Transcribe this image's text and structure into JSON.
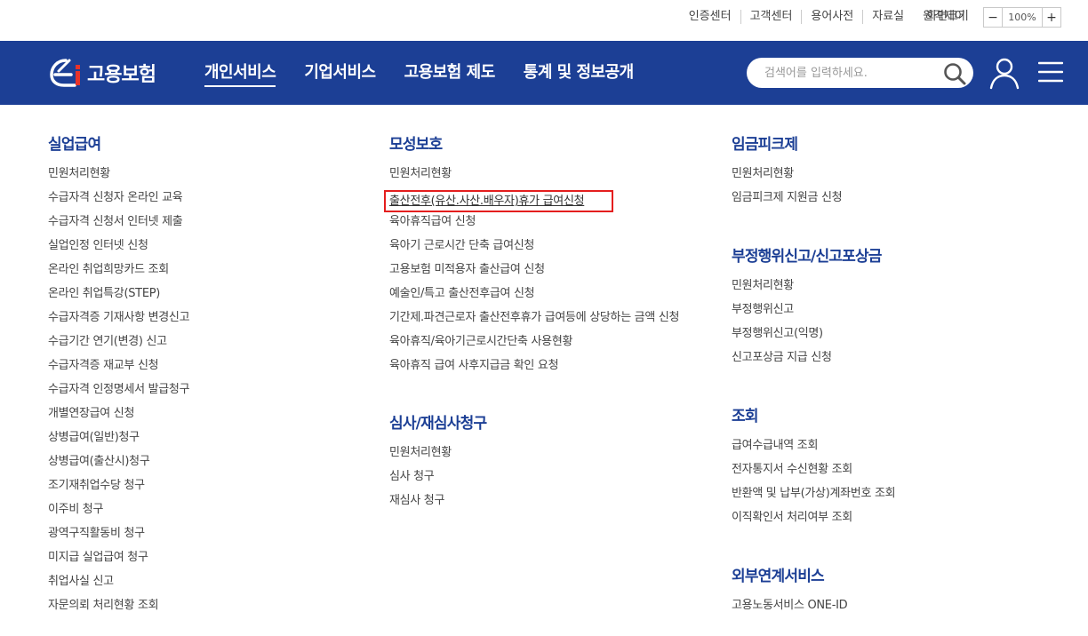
{
  "util": {
    "links": [
      "인증센터",
      "고객센터",
      "용어사전",
      "자료실",
      "원격제어"
    ],
    "zoom_label": "화면크기",
    "zoom_minus": "−",
    "zoom_value": "100%",
    "zoom_plus": "+"
  },
  "header": {
    "logo_text": "고용보험",
    "menus": [
      "개인서비스",
      "기업서비스",
      "고용보험 제도",
      "통계 및 정보공개"
    ],
    "active_menu": "개인서비스",
    "search_placeholder": "검색어를 입력하세요.",
    "brand_color": "#1c3f95"
  },
  "columns": {
    "col1": {
      "sections": [
        {
          "title": "실업급여",
          "items": [
            "민원처리현황",
            "수급자격 신청자 온라인 교육",
            "수급자격 신청서 인터넷 제출",
            "실업인정 인터넷 신청",
            "온라인 취업희망카드 조회",
            "온라인 취업특강(STEP)",
            "수급자격증 기재사항 변경신고",
            "수급기간 연기(변경) 신고",
            "수급자격증 재교부 신청",
            "수급자격 인정명세서 발급청구",
            "개별연장급여 신청",
            "상병급여(일반)청구",
            "상병급여(출산시)청구",
            "조기재취업수당 청구",
            "이주비 청구",
            "광역구직활동비 청구",
            "미지급 실업급여 청구",
            "취업사실 신고",
            "자문의뢰 처리현황 조회"
          ]
        }
      ]
    },
    "col2": {
      "sections": [
        {
          "title": "모성보호",
          "items": [
            "민원처리현황",
            "출산전후(유산.사산.배우자)휴가 급여신청",
            "육아휴직급여 신청",
            "육아기 근로시간 단축 급여신청",
            "고용보험 미적용자 출산급여 신청",
            "예술인/특고 출산전후급여 신청",
            "기간제.파견근로자 출산전후휴가 급여등에 상당하는 금액 신청",
            "육아휴직/육아기근로시간단축 사용현황",
            "육아휴직 급여 사후지급금 확인 요청"
          ]
        },
        {
          "title": "심사/재심사청구",
          "items": [
            "민원처리현황",
            "심사 청구",
            "재심사 청구"
          ]
        }
      ]
    },
    "col3": {
      "sections": [
        {
          "title": "임금피크제",
          "items": [
            "민원처리현황",
            "임금피크제 지원금 신청"
          ]
        },
        {
          "title": "부정행위신고/신고포상금",
          "items": [
            "민원처리현황",
            "부정행위신고",
            "부정행위신고(익명)",
            "신고포상금 지급 신청"
          ]
        },
        {
          "title": "조회",
          "items": [
            "급여수급내역 조회",
            "전자통지서 수신현황 조회",
            "반환액 및 납부(가상)계좌번호 조회",
            "이직확인서 처리여부 조회"
          ]
        },
        {
          "title": "외부연계서비스",
          "items": [
            "고용노동서비스 ONE-ID"
          ]
        }
      ]
    }
  },
  "highlight_color": "#e41e1e"
}
